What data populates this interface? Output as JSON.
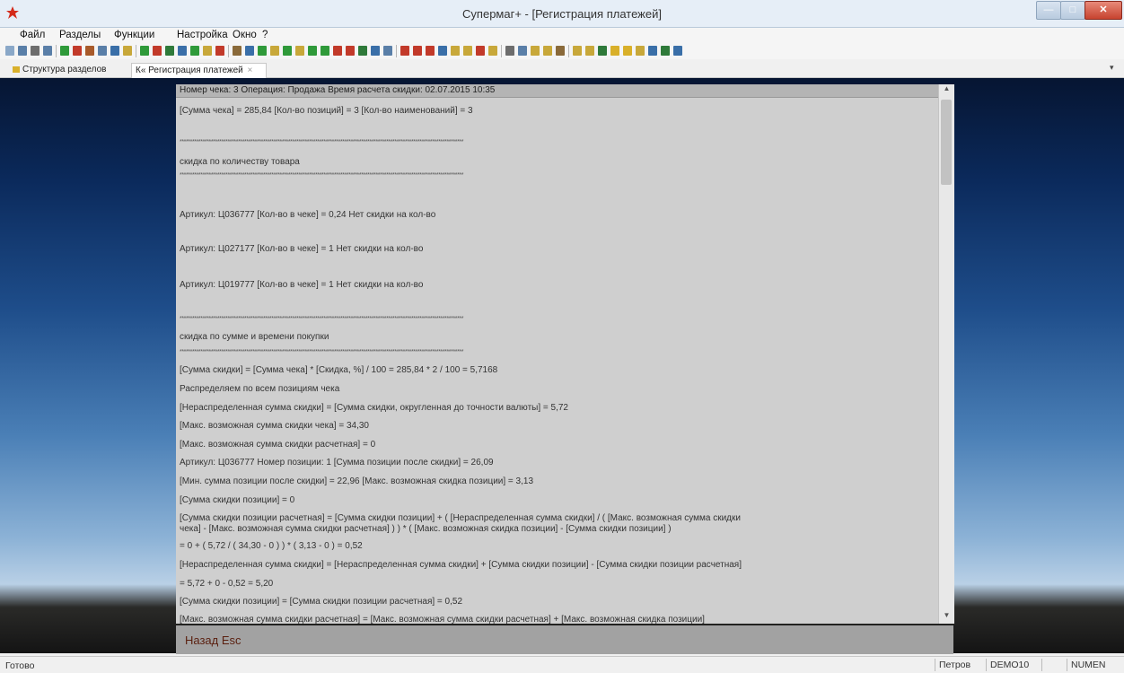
{
  "window": {
    "title": "Супермаг+  - [Регистрация платежей]",
    "min_glyph": "—",
    "max_glyph": "□",
    "close_glyph": "✕"
  },
  "menu": {
    "items": [
      {
        "label": "Файл"
      },
      {
        "label": "Разделы"
      },
      {
        "label": "Функции"
      },
      {
        "label": "Настройка"
      },
      {
        "label": "Окно"
      },
      {
        "label": "?"
      }
    ]
  },
  "tabs": {
    "structure_label": "Структура разделов",
    "active_label": "К« Регистрация платежей",
    "close_glyph": "×",
    "dropdown_glyph": "▾"
  },
  "report": {
    "header": "Номер чека: 3   Операция: Продажа   Время расчета скидки: 02.07.2015 10:35",
    "stars": "****************************************************************************************************************************************",
    "lines": [
      "[Сумма чека] = 285,84   [Кол-во позиций] = 3   [Кол-во наименований] = 3",
      "скидка по количеству товара",
      "Артикул: Ц036777   [Кол-во в чеке] = 0,24   Нет скидки на кол-во",
      "Артикул: Ц027177   [Кол-во в чеке] = 1   Нет скидки на кол-во",
      "Артикул: Ц019777   [Кол-во в чеке] = 1   Нет скидки на кол-во",
      "скидка по сумме и времени покупки",
      "[Сумма скидки] = [Сумма чека] * [Скидка, %] / 100 = 285,84 * 2 / 100 = 5,7168",
      "Распределяем по всем позициям чека",
      "[Нераспределенная сумма скидки] = [Сумма скидки, округленная до точности валюты] = 5,72",
      "[Макс. возможная сумма скидки чека] = 34,30",
      "[Макс. возможная сумма скидки расчетная] = 0",
      "Артикул: Ц036777   Номер позиции: 1   [Сумма позиции после скидки] = 26,09",
      "[Мин. сумма позиции после скидки] = 22,96   [Макс. возможная скидка позиции] = 3,13",
      "[Сумма скидки позиции] = 0",
      "[Сумма скидки позиции расчетная] = [Сумма скидки позиции] + ( [Нераспределенная сумма скидки] / ( [Макс. возможная сумма скидки",
      "чека] - [Макс. возможная сумма скидки расчетная] ) ) * ( [Макс. возможная скидка позиции] - [Сумма скидки позиции] )",
      " = 0 + ( 5,72 / ( 34,30 - 0 ) ) * ( 3,13 - 0 ) = 0,52",
      "[Нераспределенная сумма скидки] = [Нераспределенная сумма скидки] + [Сумма скидки позиции] - [Сумма скидки позиции расчетная]",
      " = 5,72 + 0 - 0,52 = 5,20",
      "[Сумма скидки позиции] = [Сумма скидки позиции расчетная] = 0,52",
      "[Макс. возможная сумма скидки расчетная] = [Макс. возможная сумма скидки расчетная] + [Макс. возможная скидка позиции]"
    ]
  },
  "scroll": {
    "up_glyph": "▲",
    "down_glyph": "▼"
  },
  "back_button": {
    "label": "Назад Esc"
  },
  "status": {
    "ready": "Готово",
    "user": "Петров",
    "db": "DEMO10",
    "mode": "NUMEN"
  }
}
